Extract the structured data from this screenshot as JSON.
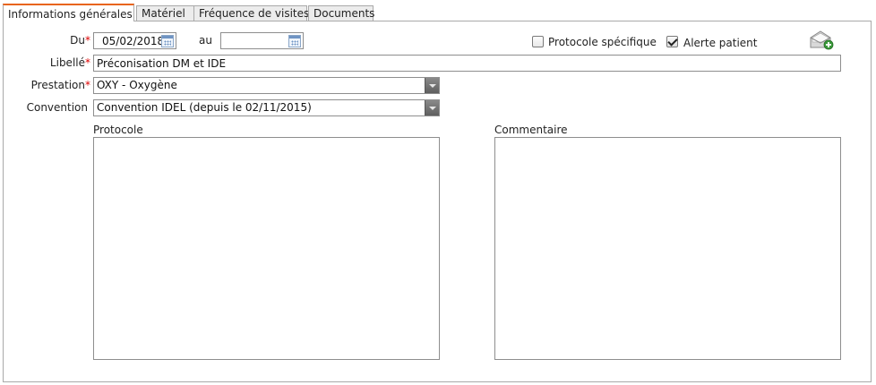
{
  "tabs": [
    {
      "label": "Informations générales",
      "active": true
    },
    {
      "label": "Matériel",
      "active": false
    },
    {
      "label": "Fréquence de visites",
      "active": false
    },
    {
      "label": "Documents",
      "active": false
    }
  ],
  "form": {
    "du": {
      "label": "Du",
      "required_mark": "*",
      "value": "05/02/2018"
    },
    "au": {
      "label": "au",
      "value": ""
    },
    "protocole_specifique": {
      "label": "Protocole spécifique",
      "checked": false
    },
    "alerte_patient": {
      "label": "Alerte patient",
      "checked": true
    },
    "libelle": {
      "label": "Libellé",
      "required_mark": "*",
      "value": "Préconisation DM et IDE"
    },
    "prestation": {
      "label": "Prestation",
      "required_mark": "*",
      "value": "OXY - Oxygène"
    },
    "convention": {
      "label": "Convention",
      "value": "Convention IDEL (depuis le 02/11/2015)"
    },
    "protocole": {
      "label": "Protocole",
      "value": ""
    },
    "commentaire": {
      "label": "Commentaire",
      "value": ""
    }
  },
  "icons": {
    "mail_add": "envelope-add-icon",
    "calendar": "calendar-icon"
  },
  "colors": {
    "active_tab_accent": "#e8641b",
    "required": "#dd0000",
    "add_badge": "#3a9a3a"
  }
}
